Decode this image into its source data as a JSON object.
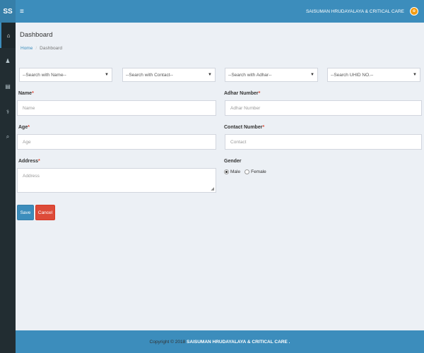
{
  "header": {
    "logo": "SS",
    "menu_icon": "≡",
    "org_name": "SAISUMAN HRUDAYALAYA & CRITICAL CARE",
    "avatar_glyph": "o"
  },
  "sidebar": {
    "items": [
      {
        "icon": "home-icon",
        "glyph": "⌂"
      },
      {
        "icon": "user-icon",
        "glyph": "♟"
      },
      {
        "icon": "table-icon",
        "glyph": "▤"
      },
      {
        "icon": "stethoscope-icon",
        "glyph": "⚕"
      },
      {
        "icon": "search-icon",
        "glyph": "⌕"
      }
    ]
  },
  "page": {
    "title": "Dashboard",
    "breadcrumb_home": "Home",
    "breadcrumb_sep": "/",
    "breadcrumb_current": "Dashboard"
  },
  "search": {
    "name": "--Search with Name--",
    "contact": "--Search with Contact--",
    "adhar": "--Search with Adhar--",
    "uhid": "--Search UHID NO.--",
    "caret": "▼"
  },
  "form": {
    "name_label": "Name",
    "name_placeholder": "Name",
    "adhar_label": "Adhar Number",
    "adhar_placeholder": "Adhar Number",
    "age_label": "Age",
    "age_placeholder": "Age",
    "contact_label": "Contact Number",
    "contact_placeholder": "Contact",
    "address_label": "Address",
    "address_placeholder": "Address",
    "gender_label": "Gender",
    "gender_male": "Male",
    "gender_female": "Female",
    "required_mark": "*"
  },
  "buttons": {
    "save": "Save",
    "cancel": "Cancel"
  },
  "footer": {
    "copyright": "Copyright © 2018",
    "org": "SAISUMAN HRUDAYALAYA & CRITICAL CARE ."
  },
  "colors": {
    "primary": "#3c8dbc",
    "danger": "#dd4b39",
    "sidebar": "#222d32",
    "background": "#ecf0f5"
  }
}
